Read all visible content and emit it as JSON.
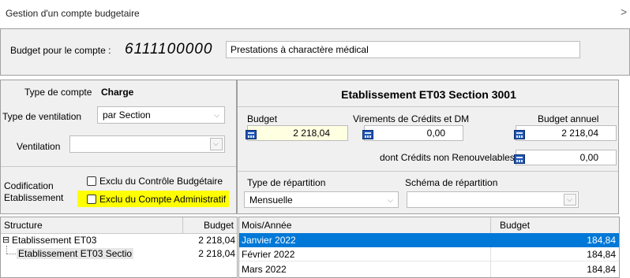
{
  "window": {
    "title": "Gestion d'un compte budgetaire",
    "close_glyph": ">"
  },
  "header": {
    "label": "Budget pour le compte :",
    "account_number": "6111100000",
    "account_name": "Prestations à charactère médical"
  },
  "left": {
    "type_compte_label": "Type de compte",
    "type_compte_value": "Charge",
    "type_ventilation_label": "Type de ventilation",
    "type_ventilation_value": "par Section",
    "ventilation_label": "Ventilation",
    "ventilation_value": "",
    "codification_label": "Codification",
    "etablissement_label": "Etablissement",
    "exclu_controle_label": "Exclu du Contrôle Budgétaire",
    "exclu_compte_admin_label": "Exclu du Compte Administratif",
    "exclu_controle_checked": false,
    "exclu_compte_admin_checked": false
  },
  "right": {
    "title": "Etablissement ET03 Section 3001",
    "budget_label": "Budget",
    "budget_value": "2 218,04",
    "virements_label": "Virements de Crédits et DM",
    "virements_value": "0,00",
    "budget_annuel_label": "Budget annuel",
    "budget_annuel_value": "2 218,04",
    "dont_credits_label": "dont Crédits non Renouvelables",
    "dont_credits_value": "0,00",
    "type_repartition_label": "Type de répartition",
    "type_repartition_value": "Mensuelle",
    "schema_repartition_label": "Schéma de répartition",
    "schema_repartition_value": ""
  },
  "structure_table": {
    "columns": [
      "Structure",
      "Budget"
    ],
    "rows": [
      {
        "name": "Etablissement ET03",
        "budget": "2 218,04",
        "expander": "⊟"
      },
      {
        "name": "Etablissement ET03 Sectio",
        "budget": "2 218,04"
      }
    ]
  },
  "months_table": {
    "columns": [
      "Mois/Année",
      "Budget"
    ],
    "rows": [
      {
        "month": "Janvier 2022",
        "budget": "184,84"
      },
      {
        "month": "Février 2022",
        "budget": "184,84"
      },
      {
        "month": "Mars 2022",
        "budget": "184,84"
      }
    ],
    "selected_row": 0
  },
  "colors": {
    "selection": "#0078d7",
    "highlight_yellow": "#ffff00",
    "budget_field_bg": "#ffffe1"
  },
  "icons": {
    "calc": "calculator-icon",
    "dropdown": "chevron-down-icon"
  }
}
